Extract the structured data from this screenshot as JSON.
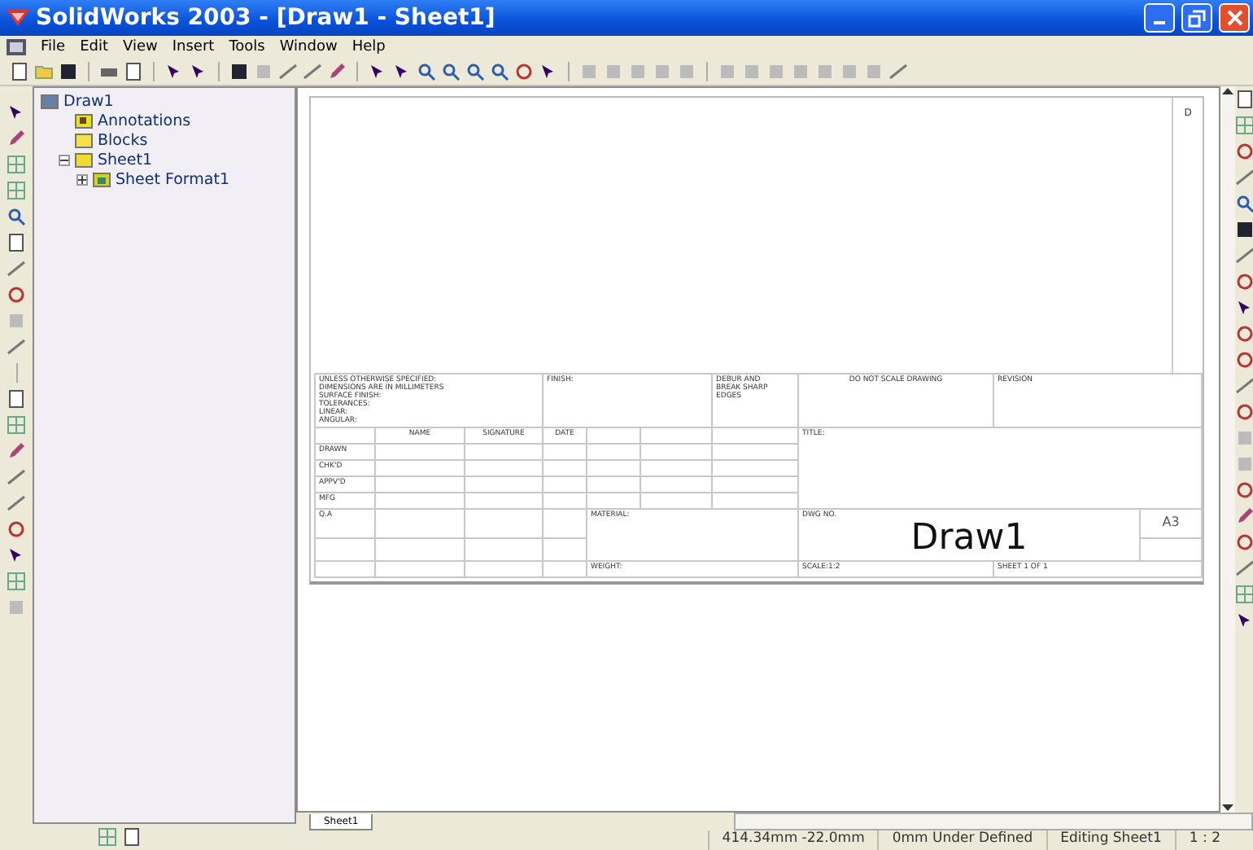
{
  "window": {
    "title": "SolidWorks 2003 - [Draw1 - Sheet1]"
  },
  "menu": [
    "File",
    "Edit",
    "View",
    "Insert",
    "Tools",
    "Window",
    "Help"
  ],
  "tree": {
    "label": "Draw1",
    "kind": "document",
    "children": [
      {
        "label": "Annotations",
        "kind": "annotations"
      },
      {
        "label": "Blocks",
        "kind": "folder"
      },
      {
        "label": "Sheet1",
        "kind": "sheet",
        "expanded": true,
        "children": [
          {
            "label": "Sheet Format1",
            "kind": "format",
            "expanded": false
          }
        ]
      }
    ]
  },
  "sheet": {
    "zone_label": "D",
    "title_block": {
      "top": [
        "UNLESS OTHERWISE SPECIFIED:\nDIMENSIONS ARE IN MILLIMETERS\nSURFACE FINISH:\nTOLERANCES:\n   LINEAR:\n   ANGULAR:",
        "FINISH:",
        "DEBUR AND\nBREAK SHARP\nEDGES",
        "DO NOT SCALE DRAWING",
        "REVISION"
      ],
      "headers": [
        "NAME",
        "SIGNATURE",
        "DATE"
      ],
      "roles": [
        "DRAWN",
        "CHK'D",
        "APPV'D",
        "MFG",
        "Q.A"
      ],
      "title_label": "TITLE:",
      "material_label": "MATERIAL:",
      "dwg_no_label": "DWG NO.",
      "dwg_no": "Draw1",
      "size": "A3",
      "weight_label": "WEIGHT:",
      "scale": "SCALE:1:2",
      "sheet_of": "SHEET 1 OF 1"
    }
  },
  "sheet_tabs": [
    {
      "label": "Sheet1",
      "selected": true
    }
  ],
  "status_bar": [
    "414.34mm -22.0mm",
    "0mm Under Defined",
    "Editing Sheet1",
    "1 : 2"
  ]
}
